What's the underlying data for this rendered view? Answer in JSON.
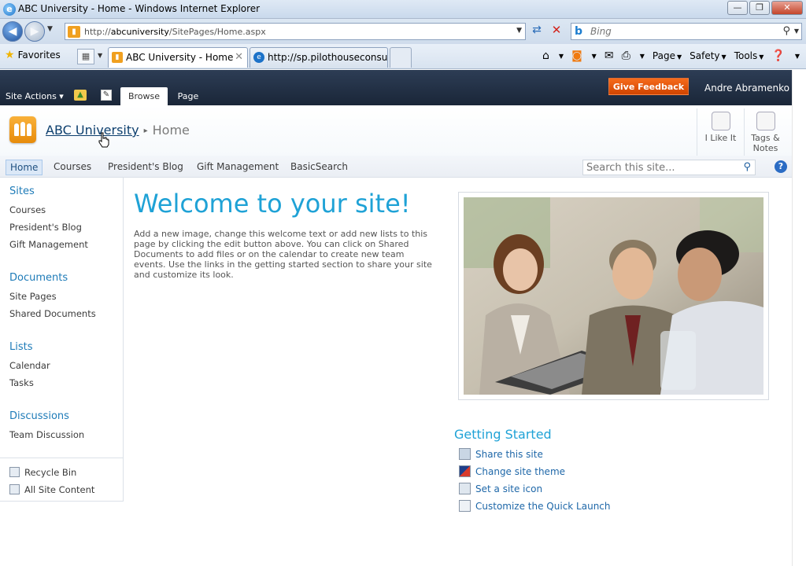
{
  "window": {
    "title": "ABC University - Home - Windows Internet Explorer",
    "ie_logo": "e",
    "minimize": "—",
    "restore": "❐",
    "close": "✕"
  },
  "address": {
    "url_prefix": "http://",
    "url_host": "abcuniversity",
    "url_path": "/SitePages/Home.aspx",
    "search_placeholder": "Bing",
    "search_engine_logo": "b"
  },
  "favorites_bar": {
    "favorites_label": "Favorites",
    "tabs": [
      {
        "label": "ABC University - Home",
        "active": true
      },
      {
        "label": "http://sp.pilothouseconsul...",
        "active": false
      }
    ],
    "commands": {
      "page_label": "Page",
      "safety_label": "Safety",
      "tools_label": "Tools"
    }
  },
  "ribbon": {
    "site_actions": "Site Actions ▾",
    "tab_browse": "Browse",
    "tab_page": "Page",
    "feedback": "Give Feedback",
    "user": "Andre Abramenko ▾"
  },
  "title_area": {
    "site_name": "ABC University",
    "separator": "▸",
    "current_page": "Home",
    "like_label": "I Like It",
    "tags_label_1": "Tags &",
    "tags_label_2": "Notes"
  },
  "top_nav": {
    "items": [
      "Home",
      "Courses",
      "President's Blog",
      "Gift Management",
      "BasicSearch"
    ],
    "search_placeholder": "Search this site...",
    "help": "?"
  },
  "quick_launch": {
    "sites": {
      "heading": "Sites",
      "items": [
        "Courses",
        "President's Blog",
        "Gift Management"
      ]
    },
    "documents": {
      "heading": "Documents",
      "items": [
        "Site Pages",
        "Shared Documents"
      ]
    },
    "lists": {
      "heading": "Lists",
      "items": [
        "Calendar",
        "Tasks"
      ]
    },
    "discussions": {
      "heading": "Discussions",
      "items": [
        "Team Discussion"
      ]
    },
    "footer": [
      "Recycle Bin",
      "All Site Content"
    ]
  },
  "main": {
    "welcome_title": "Welcome to your site!",
    "intro_text": "Add a new image, change this welcome text or add new lists to this page by clicking the edit button above. You can click on Shared Documents to add files or on the calendar to create new team events. Use the links in the getting started section to share your site and customize its look.",
    "getting_started": {
      "heading": "Getting Started",
      "items": [
        "Share this site",
        "Change site theme",
        "Set a site icon",
        "Customize the Quick Launch"
      ]
    }
  },
  "colors": {
    "ribbon_bg": "#1f2c40",
    "accent_blue": "#1fa2d6",
    "feedback_orange": "#f05a00",
    "logo_orange": "#f0a020"
  }
}
